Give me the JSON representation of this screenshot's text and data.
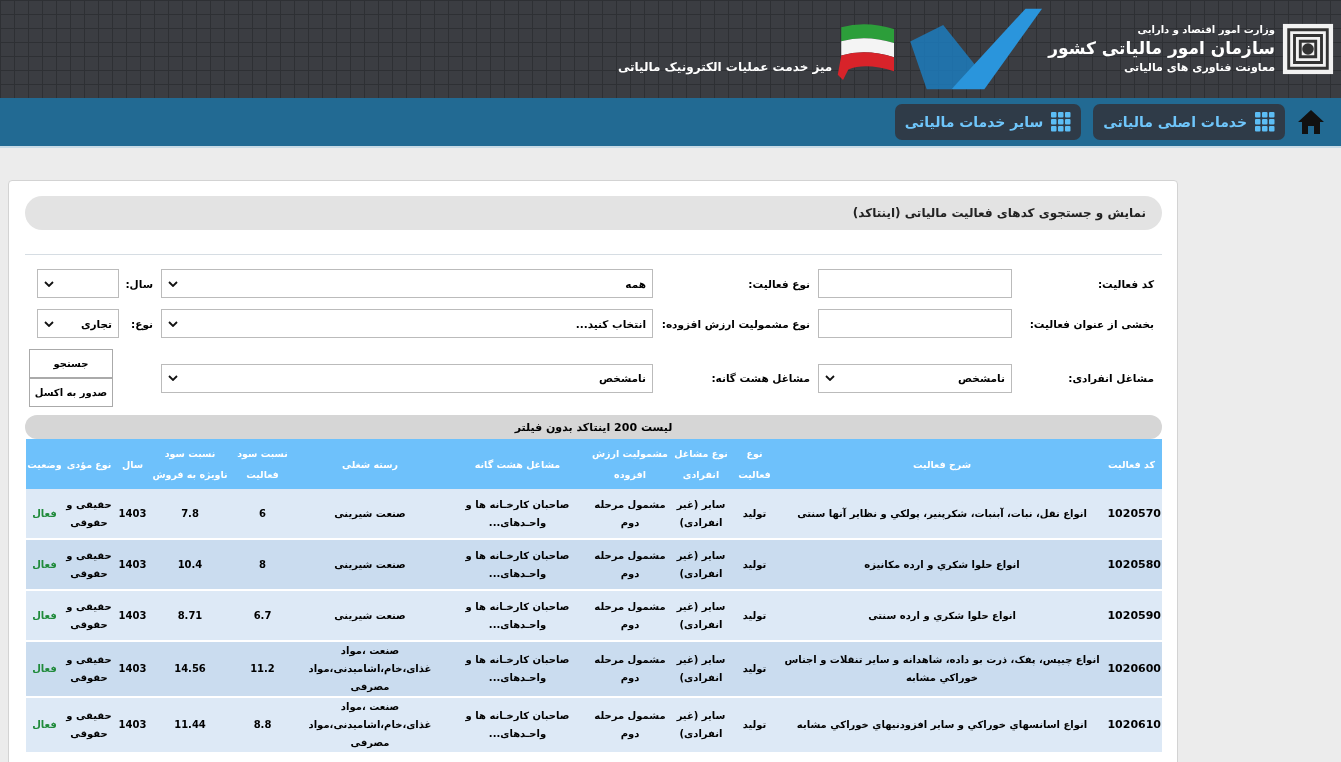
{
  "header": {
    "ministry": "وزارت امور اقتصاد و دارایی",
    "organization": "سازمان امور مالیاتی کشور",
    "deputy": "معاونت فناوری های مالیاتی",
    "service_desk": "میز خدمت عملیات الکترونیک مالیاتی"
  },
  "nav": [
    {
      "label": "خدمات اصلی مالیاتی"
    },
    {
      "label": "سایر خدمات مالیاتی"
    }
  ],
  "page_title": "نمایش و جستجوی کدهای فعالیت مالیاتی (اینتاکد)",
  "form_rows": [
    {
      "fields": [
        {
          "label": "کد فعالیت:",
          "kind": "text"
        },
        {
          "label": "نوع فعالیت:",
          "kind": "select",
          "value": "همه"
        },
        {
          "label": "سال:",
          "kind": "select"
        }
      ]
    },
    {
      "fields": [
        {
          "label": "بخشی از عنوان فعالیت:",
          "kind": "text"
        },
        {
          "label": "نوع مشمولیت ارزش افزوده:",
          "kind": "select",
          "value": "انتخاب کنید..."
        },
        {
          "label": "نوع:",
          "kind": "select",
          "value": "تجاری"
        }
      ]
    },
    {
      "fields": [
        {
          "label": "مشاغل انفرادی:",
          "kind": "select",
          "value": "نامشخص"
        },
        {
          "label": "مشاغل هشت گانه:",
          "kind": "select",
          "value": "نامشخص"
        }
      ]
    }
  ],
  "buttons": [
    "جستجو",
    "صدور به اکسل"
  ],
  "list_caption": "لیست 200 اینتاکد بدون فیلتر",
  "table": {
    "columns": [
      "کد فعالیت",
      "شرح فعالیت",
      "نوع فعالیت",
      "نوع مشاغل انفرادی",
      "مشمولیت ارزش افزوده",
      "مشاغل هشت گانه",
      "رسته شغلی",
      "نسبت سود فعالیت",
      "نسبت سود ناویژه به فروش",
      "سال",
      "نوع مؤدی",
      "وضعیت"
    ],
    "rows": [
      [
        "1020570",
        "انواع نقل، نبات، آبنبات، شکرپنیر، پولکي و نظایر آنها سنتی",
        "تولید",
        "سایر (غیر انفرادی)",
        "مشمول مرحله دوم",
        "صاحبان کارخـانه ها و واحـدهای...",
        "صنعت شیرینی",
        "6",
        "7.8",
        "1403",
        "حقیقی و حقوقی",
        "فعال"
      ],
      [
        "1020580",
        "انواع حلوا شکري و ارده مکانیزه",
        "تولید",
        "سایر (غیر انفرادی)",
        "مشمول مرحله دوم",
        "صاحبان کارخـانه ها و واحـدهای...",
        "صنعت شیرینی",
        "8",
        "10.4",
        "1403",
        "حقیقی و حقوقی",
        "فعال"
      ],
      [
        "1020590",
        "انواع حلوا شکري و ارده سنتی",
        "تولید",
        "سایر (غیر انفرادی)",
        "مشمول مرحله دوم",
        "صاحبان کارخـانه ها و واحـدهای...",
        "صنعت شیرینی",
        "6.7",
        "8.71",
        "1403",
        "حقیقی و حقوقی",
        "فعال"
      ],
      [
        "1020600",
        "انواع چیپس، پفک، ذرت بو داده، شاهدانه و سایر تنقلات و اجناس خوراکي مشابه",
        "تولید",
        "سایر (غیر انفرادی)",
        "مشمول مرحله دوم",
        "صاحبان کارخـانه ها و واحـدهای...",
        "صنعت ،مواد غذای،خام،اشامیدنی،مواد مصرفی",
        "11.2",
        "14.56",
        "1403",
        "حقیقی و حقوقی",
        "فعال"
      ],
      [
        "1020610",
        "انواع اسانسهاي خوراکي و سایر افزودنیهاي خوراکي مشابه",
        "تولید",
        "سایر (غیر انفرادی)",
        "مشمول مرحله دوم",
        "صاحبان کارخـانه ها و واحـدهای...",
        "صنعت ،مواد غذای،خام،اشامیدنی،مواد مصرفی",
        "8.8",
        "11.44",
        "1403",
        "حقیقی و حقوقی",
        "فعال"
      ]
    ]
  }
}
